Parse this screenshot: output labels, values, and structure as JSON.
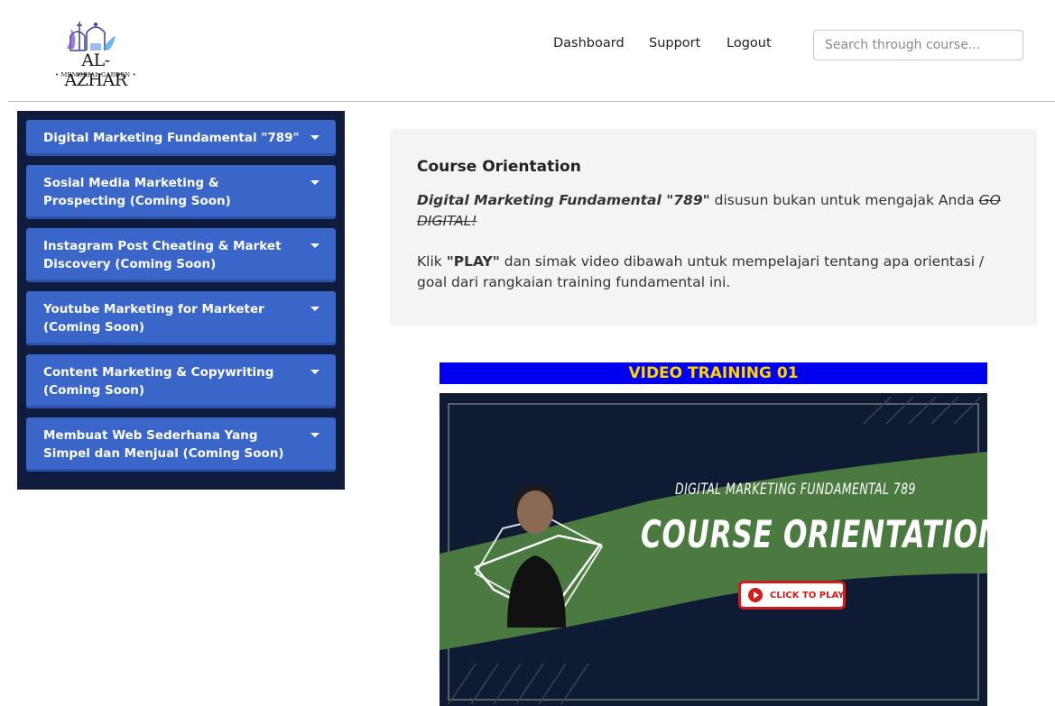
{
  "header": {
    "logo": {
      "name": "AL-AZHAR",
      "subtitle": "• MEMORIAL GARDEN •"
    },
    "nav": {
      "dashboard": "Dashboard",
      "support": "Support",
      "logout": "Logout"
    },
    "search": {
      "placeholder": "Search through course..."
    }
  },
  "sidebar": {
    "items": [
      {
        "label": "Digital Marketing Fundamental \"789\""
      },
      {
        "label": "Sosial Media Marketing & Prospecting (Coming Soon)"
      },
      {
        "label": "Instagram Post Cheating & Market Discovery (Coming Soon)"
      },
      {
        "label": "Youtube Marketing for Marketer (Coming Soon)"
      },
      {
        "label": "Content Marketing & Copywriting (Coming Soon)"
      },
      {
        "label": "Membuat Web Sederhana Yang Simpel dan Menjual (Coming Soon)"
      }
    ]
  },
  "main": {
    "title": "Course Orientation",
    "para1": {
      "course_name": "Digital Marketing Fundamental \"789\"",
      "text": " disusun bukan untuk mengajak Anda ",
      "struck": "GO DIGITAL!"
    },
    "para2": {
      "prefix": "Klik ",
      "play": "\"PLAY\"",
      "text": " dan simak video dibawah untuk mempelajari tentang apa orientasi / goal dari rangkaian training fundamental ini."
    }
  },
  "video": {
    "banner": "VIDEO TRAINING 01",
    "subtitle": "DIGITAL MARKETING FUNDAMENTAL 789",
    "title": "COURSE ORIENTATION",
    "play_label": "CLICK TO PLAY",
    "colors": {
      "background": "#0f1b33",
      "accent_green": "#4a7a3f",
      "play_red": "#d01c1c"
    }
  },
  "colors": {
    "sidebar_bg": "#0f1c3d",
    "sidebar_item": "#3a65c9",
    "banner_bg": "#0000ee",
    "banner_text": "#ffd400"
  }
}
